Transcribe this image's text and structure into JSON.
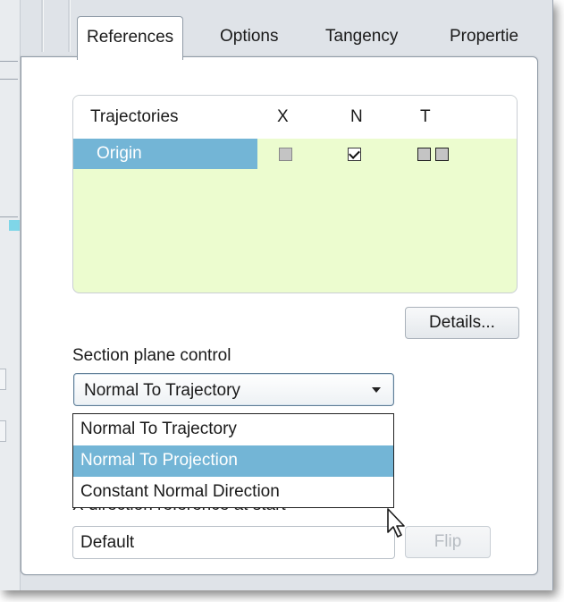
{
  "tabs": [
    {
      "label": "References",
      "active": true
    },
    {
      "label": "Options",
      "active": false
    },
    {
      "label": "Tangency",
      "active": false
    },
    {
      "label": "Propertie",
      "active": false
    }
  ],
  "trajectories": {
    "columns": [
      "Trajectories",
      "X",
      "N",
      "T"
    ],
    "rows": [
      {
        "name": "Origin",
        "x": false,
        "n": true,
        "t": [
          false,
          false
        ]
      }
    ]
  },
  "details_button": "Details...",
  "section_plane": {
    "label": "Section plane control",
    "selected": "Normal To Trajectory",
    "options": [
      "Normal To Trajectory",
      "Normal To Projection",
      "Constant Normal Direction"
    ],
    "highlighted": "Normal To Projection"
  },
  "x_direction": {
    "label": "X direction reference at start",
    "value": "Default",
    "flip_button": "Flip"
  },
  "colors": {
    "selection": "#73b5d6",
    "table_background": "#ecfccf"
  }
}
